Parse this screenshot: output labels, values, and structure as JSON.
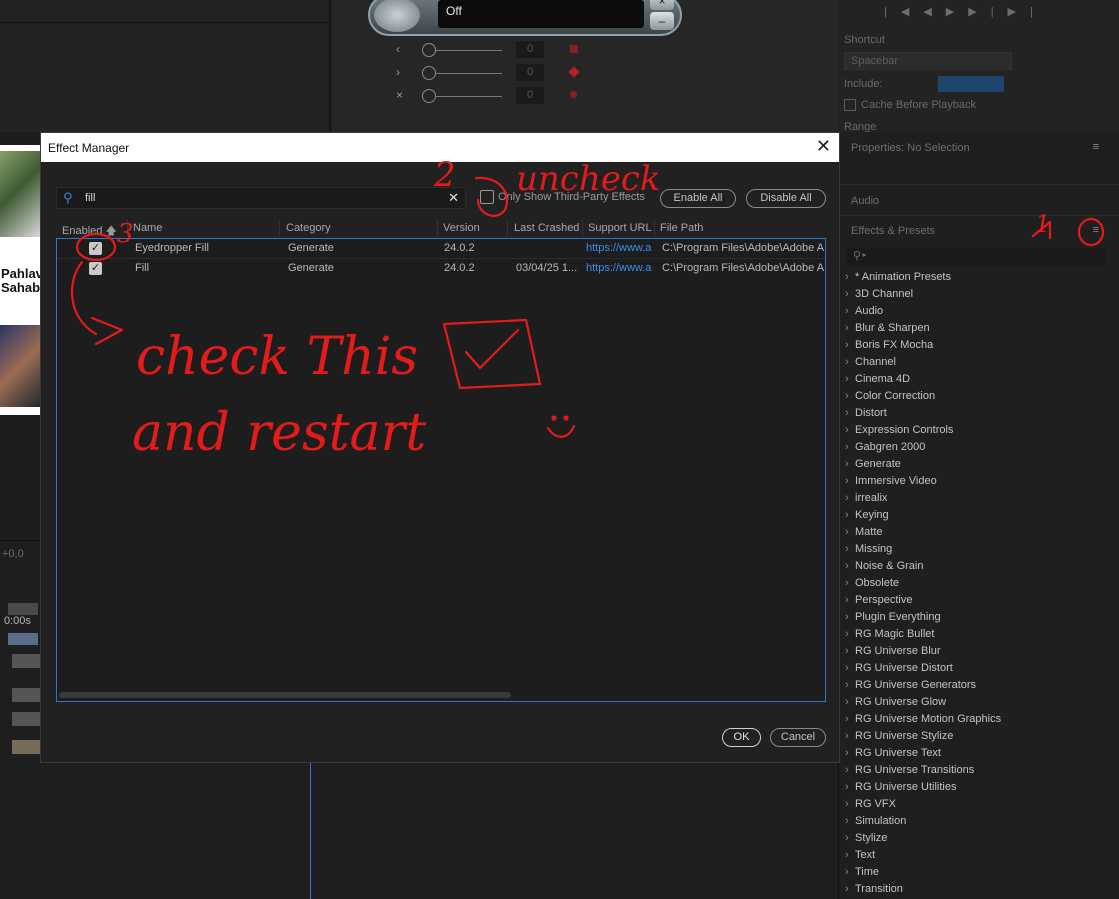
{
  "background": {
    "mic_status": "Off",
    "mixer_values": [
      "0",
      "0",
      "0"
    ],
    "shortcut_label": "Shortcut",
    "shortcut_value": "Spacebar",
    "include_label": "Include:",
    "cache_label": "Cache Before Playback",
    "range_label": "Range",
    "timeline_time": "0:00s",
    "timeline_offset": "+0,0",
    "preview_text": "Pahlav\nSahab"
  },
  "right_panel": {
    "properties_title": "Properties: No Selection",
    "audio_title": "Audio",
    "effects_title": "Effects & Presets",
    "categories": [
      "* Animation Presets",
      "3D Channel",
      "Audio",
      "Blur & Sharpen",
      "Boris FX Mocha",
      "Channel",
      "Cinema 4D",
      "Color Correction",
      "Distort",
      "Expression Controls",
      "Gabgren 2000",
      "Generate",
      "Immersive Video",
      "irrealix",
      "Keying",
      "Matte",
      "Missing",
      "Noise & Grain",
      "Obsolete",
      "Perspective",
      "Plugin Everything",
      "RG Magic Bullet",
      "RG Universe Blur",
      "RG Universe Distort",
      "RG Universe Generators",
      "RG Universe Glow",
      "RG Universe Motion Graphics",
      "RG Universe Stylize",
      "RG Universe Text",
      "RG Universe Transitions",
      "RG Universe Utilities",
      "RG VFX",
      "Simulation",
      "Stylize",
      "Text",
      "Time",
      "Transition"
    ]
  },
  "dialog": {
    "title": "Effect Manager",
    "search_value": "fill",
    "third_party_label": "Only Show Third-Party Effects",
    "enable_all": "Enable All",
    "disable_all": "Disable All",
    "columns": [
      "Enabled",
      "Name",
      "Category",
      "Version",
      "Last Crashed",
      "Support URL",
      "File Path"
    ],
    "rows": [
      {
        "enabled": true,
        "name": "Eyedropper Fill",
        "category": "Generate",
        "version": "24.0.2",
        "last_crashed": "",
        "support_url": "https://www.a",
        "file_path": "C:\\Program Files\\Adobe\\Adobe A"
      },
      {
        "enabled": true,
        "name": "Fill",
        "category": "Generate",
        "version": "24.0.2",
        "last_crashed": "03/04/25 1...",
        "support_url": "https://www.a",
        "file_path": "C:\\Program Files\\Adobe\\Adobe A"
      }
    ],
    "ok": "OK",
    "cancel": "Cancel"
  },
  "annotations": {
    "num1": "1",
    "num2": "2",
    "num3": "3",
    "uncheck": "uncheck",
    "check_this": "check This",
    "and_restart": "and restart",
    "color": "#e41b1b"
  }
}
